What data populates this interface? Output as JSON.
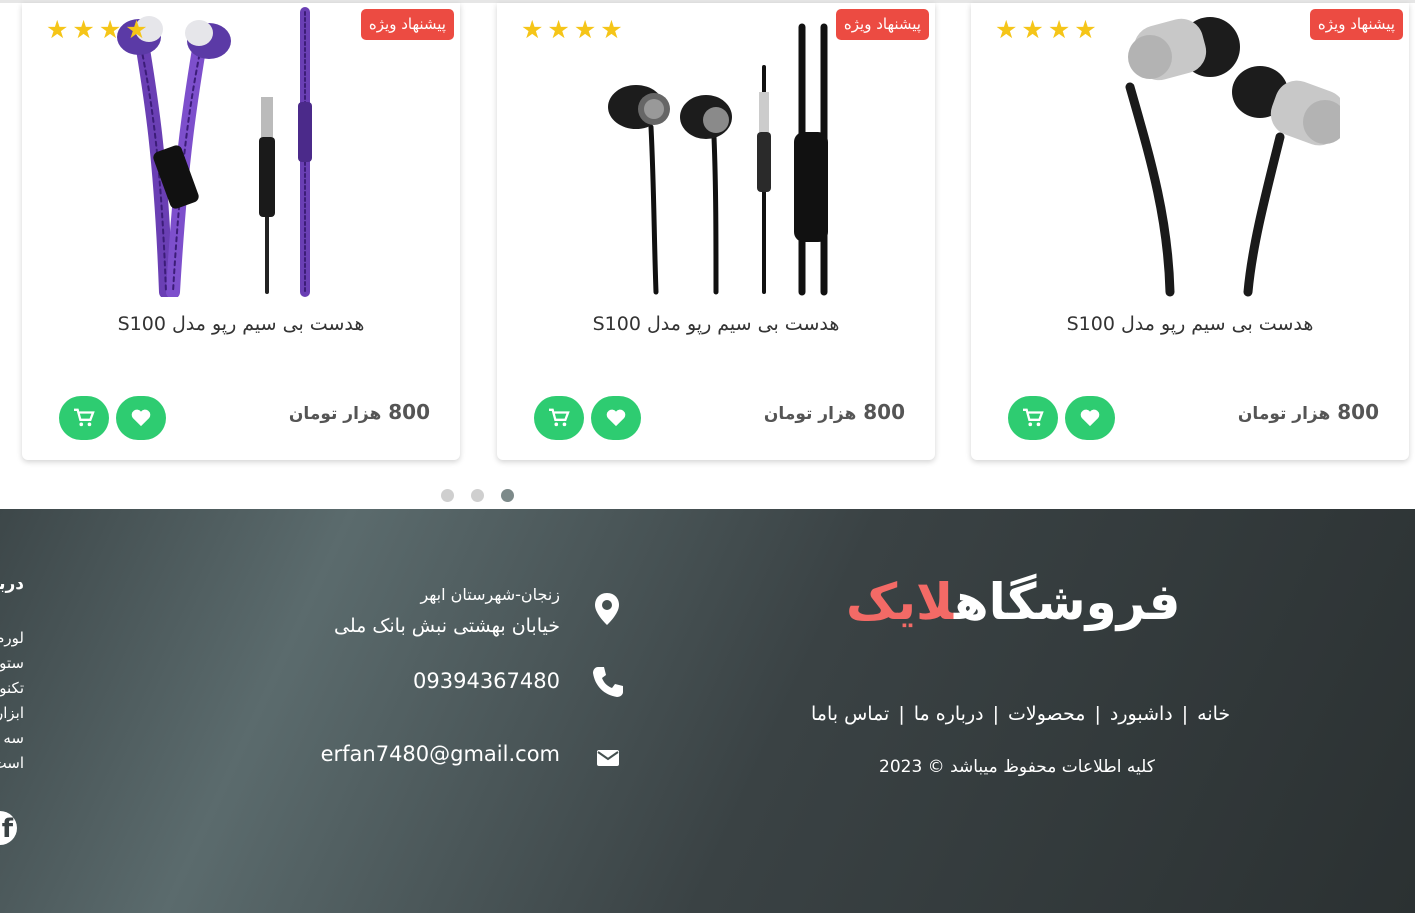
{
  "products": [
    {
      "badge": "پیشنهاد ویژه",
      "title": "هدست بی سیم رپو مدل S100",
      "price": "800",
      "unit": "هزار تومان",
      "rating": 4,
      "image": "zipper-earphones-purple"
    },
    {
      "badge": "پیشنهاد ویژه",
      "title": "هدست بی سیم رپو مدل S100",
      "price": "800",
      "unit": "هزار تومان",
      "rating": 4,
      "image": "black-earphones"
    },
    {
      "badge": "پیشنهاد ویژه",
      "title": "هدست بی سیم رپو مدل S100",
      "price": "800",
      "unit": "هزار تومان",
      "rating": 4,
      "image": "silver-earphones"
    }
  ],
  "carousel": {
    "dots": 3,
    "active_index": 2
  },
  "footer": {
    "brand_main": "فروشگاه",
    "brand_accent": "لایک",
    "nav": [
      "خانه",
      "داشبورد",
      "محصولات",
      "درباره ما",
      "تماس باما"
    ],
    "copyright": "کلیه اطلاعات محفوظ میباشد © 2023",
    "address_line1": "زنجان-شهرستان ابهر",
    "address_line2": "خیابان بهشتی نبش بانک ملی",
    "phone": "09394367480",
    "email": "erfan7480@gmail.com",
    "about_title": "دربا",
    "about_lines": [
      "لورم",
      "ستو",
      "تکنو",
      "ابزار",
      "سه",
      "است"
    ]
  },
  "colors": {
    "accent": "#f36a66",
    "badge": "#ec4b42",
    "button": "#2ecc71",
    "star": "#f5c518"
  }
}
